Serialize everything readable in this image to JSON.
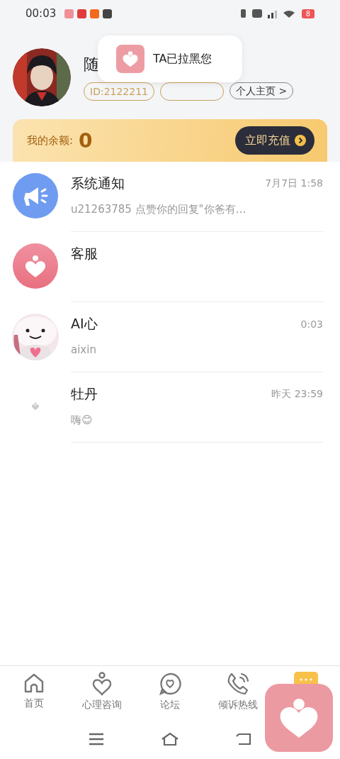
{
  "status_bar": {
    "time": "00:03",
    "battery": "8"
  },
  "profile": {
    "name": "随",
    "id_badge": "ID:2122211",
    "home_link": "个人主页 >"
  },
  "toast": {
    "text": "TA已拉黑您"
  },
  "balance": {
    "label": "我的余额:",
    "amount": "0",
    "button": "立即充值"
  },
  "conversations": [
    {
      "kind": "system",
      "title": "系统通知",
      "time": "7月7日 1:58",
      "preview": "u21263785 点赞你的回复\"你爸有…"
    },
    {
      "kind": "service",
      "title": "客服"
    },
    {
      "kind": "bot",
      "title": "AI心",
      "time": "0:03",
      "preview": "aixin"
    },
    {
      "kind": "user",
      "title": "牡丹",
      "time": "昨天 23:59",
      "preview": "嗨😊"
    }
  ],
  "tabs": [
    {
      "kind": "home",
      "label": "首页"
    },
    {
      "kind": "consult",
      "label": "心理咨询"
    },
    {
      "kind": "forum",
      "label": "论坛"
    },
    {
      "kind": "hotline",
      "label": "倾诉热线"
    },
    {
      "kind": "more"
    }
  ]
}
